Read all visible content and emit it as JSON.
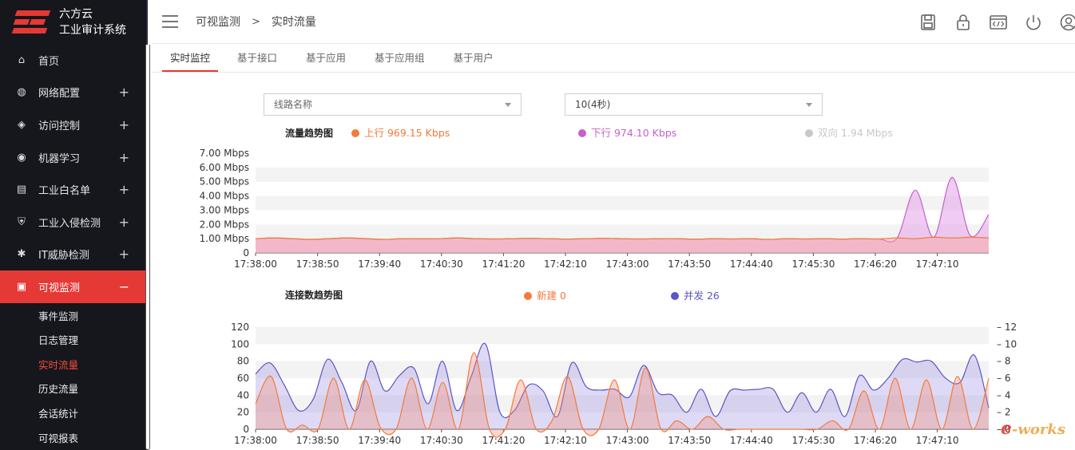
{
  "app": {
    "brand_line1": "六方云",
    "brand_line2": "工业审计系统"
  },
  "sidebar": {
    "items": [
      {
        "label": "首页",
        "icon": "home-icon",
        "expand": ""
      },
      {
        "label": "网络配置",
        "icon": "globe-icon",
        "expand": "+"
      },
      {
        "label": "访问控制",
        "icon": "layers-icon",
        "expand": "+"
      },
      {
        "label": "机器学习",
        "icon": "brain-icon",
        "expand": "+"
      },
      {
        "label": "工业白名单",
        "icon": "list-icon",
        "expand": "+"
      },
      {
        "label": "工业入侵检测",
        "icon": "shield-icon",
        "expand": "+"
      },
      {
        "label": "IT威胁检测",
        "icon": "bug-icon",
        "expand": "+"
      },
      {
        "label": "可视监测",
        "icon": "monitor-icon",
        "expand": "−"
      }
    ],
    "subitems": [
      "事件监测",
      "日志管理",
      "实时流量",
      "历史流量",
      "会话统计",
      "可视报表"
    ],
    "active_subitem": "实时流量"
  },
  "header": {
    "breadcrumb_root": "可视监测",
    "breadcrumb_sep": ">",
    "breadcrumb_current": "实时流量"
  },
  "header_tools": [
    "save-icon",
    "lock-icon",
    "code-window-icon",
    "power-icon",
    "user-icon"
  ],
  "tabs": [
    "实时监控",
    "基于接口",
    "基于应用",
    "基于应用组",
    "基于用户"
  ],
  "active_tab": "实时监控",
  "filters": {
    "link_placeholder": "线路名称",
    "interval_value": "10(4秒)"
  },
  "colors": {
    "accent": "#e53935",
    "up": "#f47a3b",
    "down": "#c75fcf",
    "both": "#c8c8c8",
    "new": "#f47a3b",
    "concurrent": "#5b55c7"
  },
  "watermark": "e-works",
  "chart_data": [
    {
      "type": "area",
      "title": "流量趋势图",
      "legend": [
        {
          "name": "上行",
          "value_text": "969.15 Kbps",
          "color": "#f47a3b"
        },
        {
          "name": "下行",
          "value_text": "974.10 Kbps",
          "color": "#c75fcf"
        },
        {
          "name": "双向",
          "value_text": "1.94 Mbps",
          "color": "#c8c8c8"
        }
      ],
      "ylim": [
        0,
        7
      ],
      "y_ticks": [
        "0",
        "1.00 Mbps",
        "2.00 Mbps",
        "3.00 Mbps",
        "4.00 Mbps",
        "5.00 Mbps",
        "6.00 Mbps",
        "7.00 Mbps"
      ],
      "x_ticks": [
        "17:38:00",
        "17:38:50",
        "17:39:40",
        "17:40:30",
        "17:41:20",
        "17:42:10",
        "17:43:00",
        "17:43:50",
        "17:44:40",
        "17:45:30",
        "17:46:20",
        "17:47:10"
      ],
      "series": [
        {
          "name": "上行",
          "values": [
            1.0,
            1.05,
            1.0,
            0.95,
            1.0,
            1.05,
            1.0,
            0.95,
            1.0,
            1.0,
            1.0,
            1.05,
            1.0,
            0.98,
            1.0,
            1.02,
            1.0,
            0.97,
            1.0,
            1.02,
            1.0,
            0.98,
            1.0,
            1.0,
            0.96,
            1.0,
            0.98,
            1.0,
            0.95,
            1.0,
            0.98,
            1.0,
            0.97,
            1.0,
            0.98,
            1.05,
            1.0,
            1.1,
            1.05,
            1.1,
            1.05
          ]
        },
        {
          "name": "下行",
          "values": [
            1.0,
            1.05,
            1.0,
            0.95,
            1.0,
            1.05,
            1.0,
            0.95,
            1.0,
            1.0,
            1.0,
            1.05,
            1.0,
            0.98,
            1.0,
            1.02,
            1.0,
            0.97,
            1.0,
            1.02,
            1.0,
            0.98,
            1.0,
            1.0,
            0.96,
            1.0,
            0.98,
            1.0,
            0.95,
            1.0,
            0.98,
            1.0,
            0.97,
            1.0,
            0.98,
            1.05,
            4.4,
            1.1,
            5.3,
            1.2,
            2.7
          ]
        }
      ]
    },
    {
      "type": "area",
      "title": "连接数趋势图",
      "legend": [
        {
          "name": "新建",
          "value_text": "0",
          "color": "#f47a3b"
        },
        {
          "name": "并发",
          "value_text": "26",
          "color": "#5b55c7"
        }
      ],
      "ylim_left": [
        0,
        120
      ],
      "ylim_right": [
        0,
        12
      ],
      "y_ticks_left": [
        "0",
        "20",
        "40",
        "60",
        "80",
        "100",
        "120"
      ],
      "y_ticks_right": [
        "0",
        "2",
        "4",
        "6",
        "8",
        "10",
        "12"
      ],
      "x_ticks": [
        "17:38:00",
        "17:38:50",
        "17:39:40",
        "17:40:30",
        "17:41:20",
        "17:42:10",
        "17:43:00",
        "17:43:50",
        "17:44:40",
        "17:45:30",
        "17:46:20",
        "17:47:10"
      ],
      "series": [
        {
          "name": "新建",
          "values": [
            30,
            62,
            0,
            5,
            0,
            60,
            0,
            58,
            2,
            0,
            60,
            0,
            55,
            0,
            90,
            0,
            0,
            58,
            0,
            10,
            62,
            0,
            0,
            58,
            0,
            72,
            0,
            10,
            0,
            15,
            0,
            0,
            0,
            0,
            0,
            0,
            0,
            10,
            0,
            45,
            0,
            60,
            0,
            58,
            0,
            62,
            0,
            60
          ]
        },
        {
          "name": "并发",
          "values": [
            6.5,
            7.8,
            5.2,
            2.2,
            3.5,
            8.2,
            5.5,
            2.2,
            8.0,
            4.5,
            6.3,
            7.2,
            3.0,
            8.0,
            2.2,
            6.2,
            10.0,
            2.0,
            2.2,
            5.2,
            4.5,
            1.5,
            7.8,
            5.0,
            4.6,
            4.7,
            3.8,
            7.5,
            4.3,
            4.0,
            2.0,
            4.7,
            1.5,
            4.5,
            4.6,
            4.7,
            4.7,
            2.0,
            4.3,
            2.0,
            4.7,
            1.5,
            6.3,
            4.6,
            6.0,
            8.2,
            7.9,
            8.0,
            6.0,
            5.5,
            8.7,
            2.5
          ]
        }
      ]
    }
  ]
}
